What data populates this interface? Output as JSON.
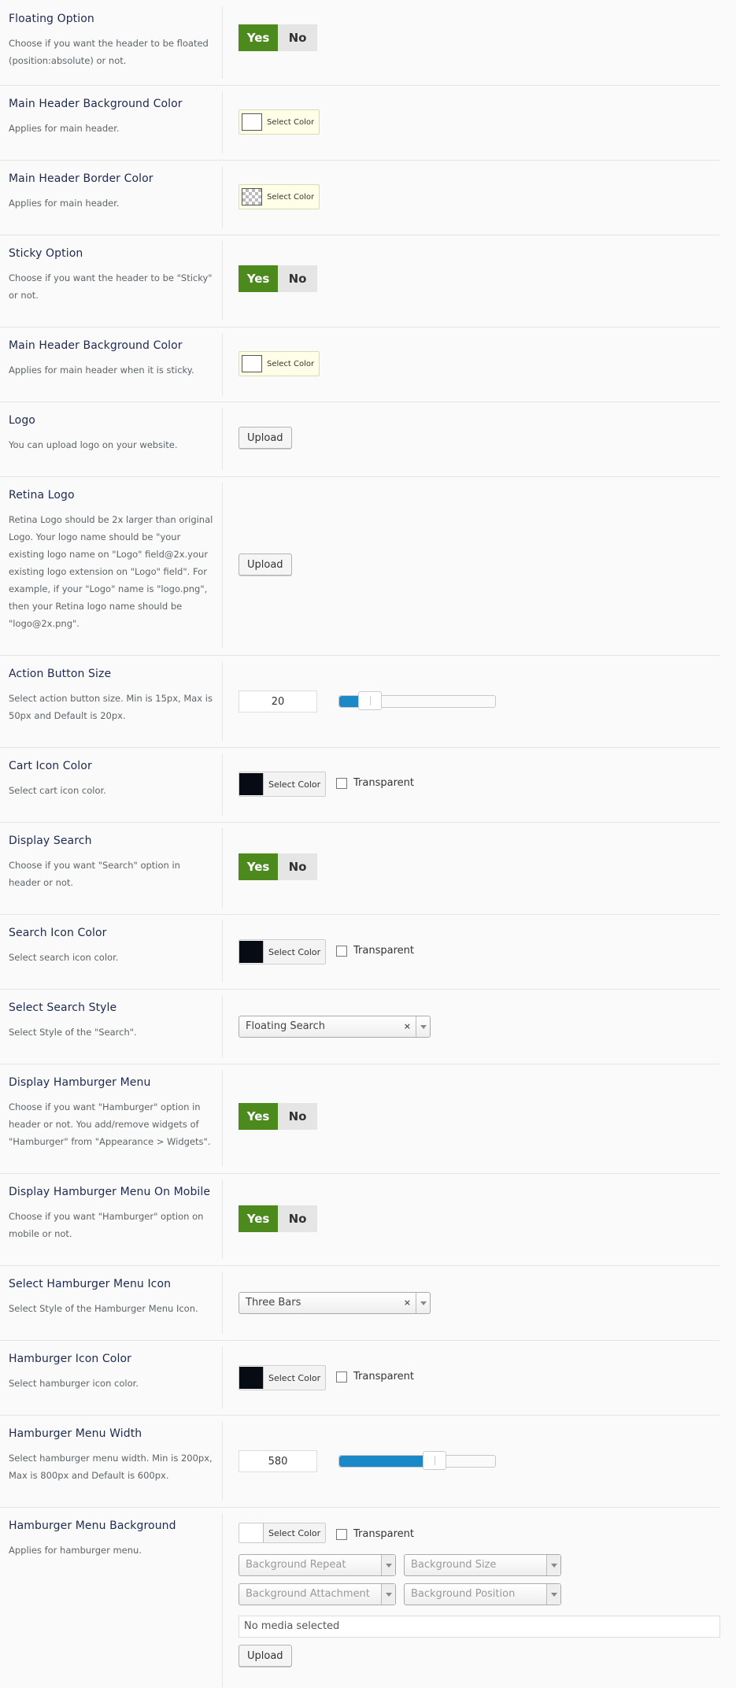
{
  "rows": {
    "floating": {
      "title": "Floating Option",
      "desc": "Choose if you want the header to be floated (position:absolute) or not.",
      "yes": "Yes",
      "no": "No"
    },
    "main_bg": {
      "title": "Main Header Background Color",
      "desc": "Applies for main header.",
      "color_label": "Select Color"
    },
    "main_border": {
      "title": "Main Header Border Color",
      "desc": "Applies for main header.",
      "color_label": "Select Color"
    },
    "sticky": {
      "title": "Sticky Option",
      "desc": "Choose if you want the header to be \"Sticky\" or not.",
      "yes": "Yes",
      "no": "No"
    },
    "sticky_bg": {
      "title": "Main Header Background Color",
      "desc": "Applies for main header when it is sticky.",
      "color_label": "Select Color"
    },
    "logo": {
      "title": "Logo",
      "desc": "You can upload logo on your website.",
      "button": "Upload"
    },
    "retina": {
      "title": "Retina Logo",
      "desc": "Retina Logo should be 2x larger than original Logo. Your logo name should be \"your existing logo name on \"Logo\" field@2x.your existing logo extension on \"Logo\" field\". For example, if your \"Logo\" name is \"logo.png\", then your Retina logo name should be \"logo@2x.png\".",
      "button": "Upload"
    },
    "action_size": {
      "title": "Action Button Size",
      "desc": "Select action button size. Min is 15px, Max is 50px and Default is 20px.",
      "value": "20",
      "min": 15,
      "max": 50
    },
    "cart_color": {
      "title": "Cart Icon Color",
      "desc": "Select cart icon color.",
      "color_label": "Select Color",
      "transparent": "Transparent",
      "swatch": "#060b14"
    },
    "display_search": {
      "title": "Display Search",
      "desc": "Choose if you want \"Search\" option in header or not.",
      "yes": "Yes",
      "no": "No"
    },
    "search_color": {
      "title": "Search Icon Color",
      "desc": "Select search icon color.",
      "color_label": "Select Color",
      "transparent": "Transparent",
      "swatch": "#060b14"
    },
    "search_style": {
      "title": "Select Search Style",
      "desc": "Select Style of the \"Search\".",
      "selected": "Floating Search",
      "clear": "×"
    },
    "hamburger": {
      "title": "Display Hamburger Menu",
      "desc": "Choose if you want \"Hamburger\" option in header or not. You add/remove widgets of \"Hamburger\" from \"Appearance > Widgets\".",
      "yes": "Yes",
      "no": "No"
    },
    "hamburger_mobile": {
      "title": "Display Hamburger Menu On Mobile",
      "desc": "Choose if you want \"Hamburger\" option on mobile or not.",
      "yes": "Yes",
      "no": "No"
    },
    "hamburger_icon": {
      "title": "Select Hamburger Menu Icon",
      "desc": "Select Style of the Hamburger Menu Icon.",
      "selected": "Three Bars",
      "clear": "×"
    },
    "hamburger_color": {
      "title": "Hamburger Icon Color",
      "desc": "Select hamburger icon color.",
      "color_label": "Select Color",
      "transparent": "Transparent",
      "swatch": "#060b14"
    },
    "hamburger_width": {
      "title": "Hamburger Menu Width",
      "desc": "Select hamburger menu width. Min is 200px, Max is 800px and Default is 600px.",
      "value": "580",
      "min": 200,
      "max": 800
    },
    "hamburger_bg": {
      "title": "Hamburger Menu Background",
      "desc": "Applies for hamburger menu.",
      "color_label": "Select Color",
      "transparent": "Transparent",
      "repeat": "Background Repeat",
      "size": "Background Size",
      "attachment": "Background Attachment",
      "position": "Background Position",
      "media": "No media selected",
      "button": "Upload"
    }
  },
  "colors": {
    "yes_green": "#4d8a1e",
    "slider_blue": "#1b88c8",
    "title_navy": "#1d2a50"
  }
}
